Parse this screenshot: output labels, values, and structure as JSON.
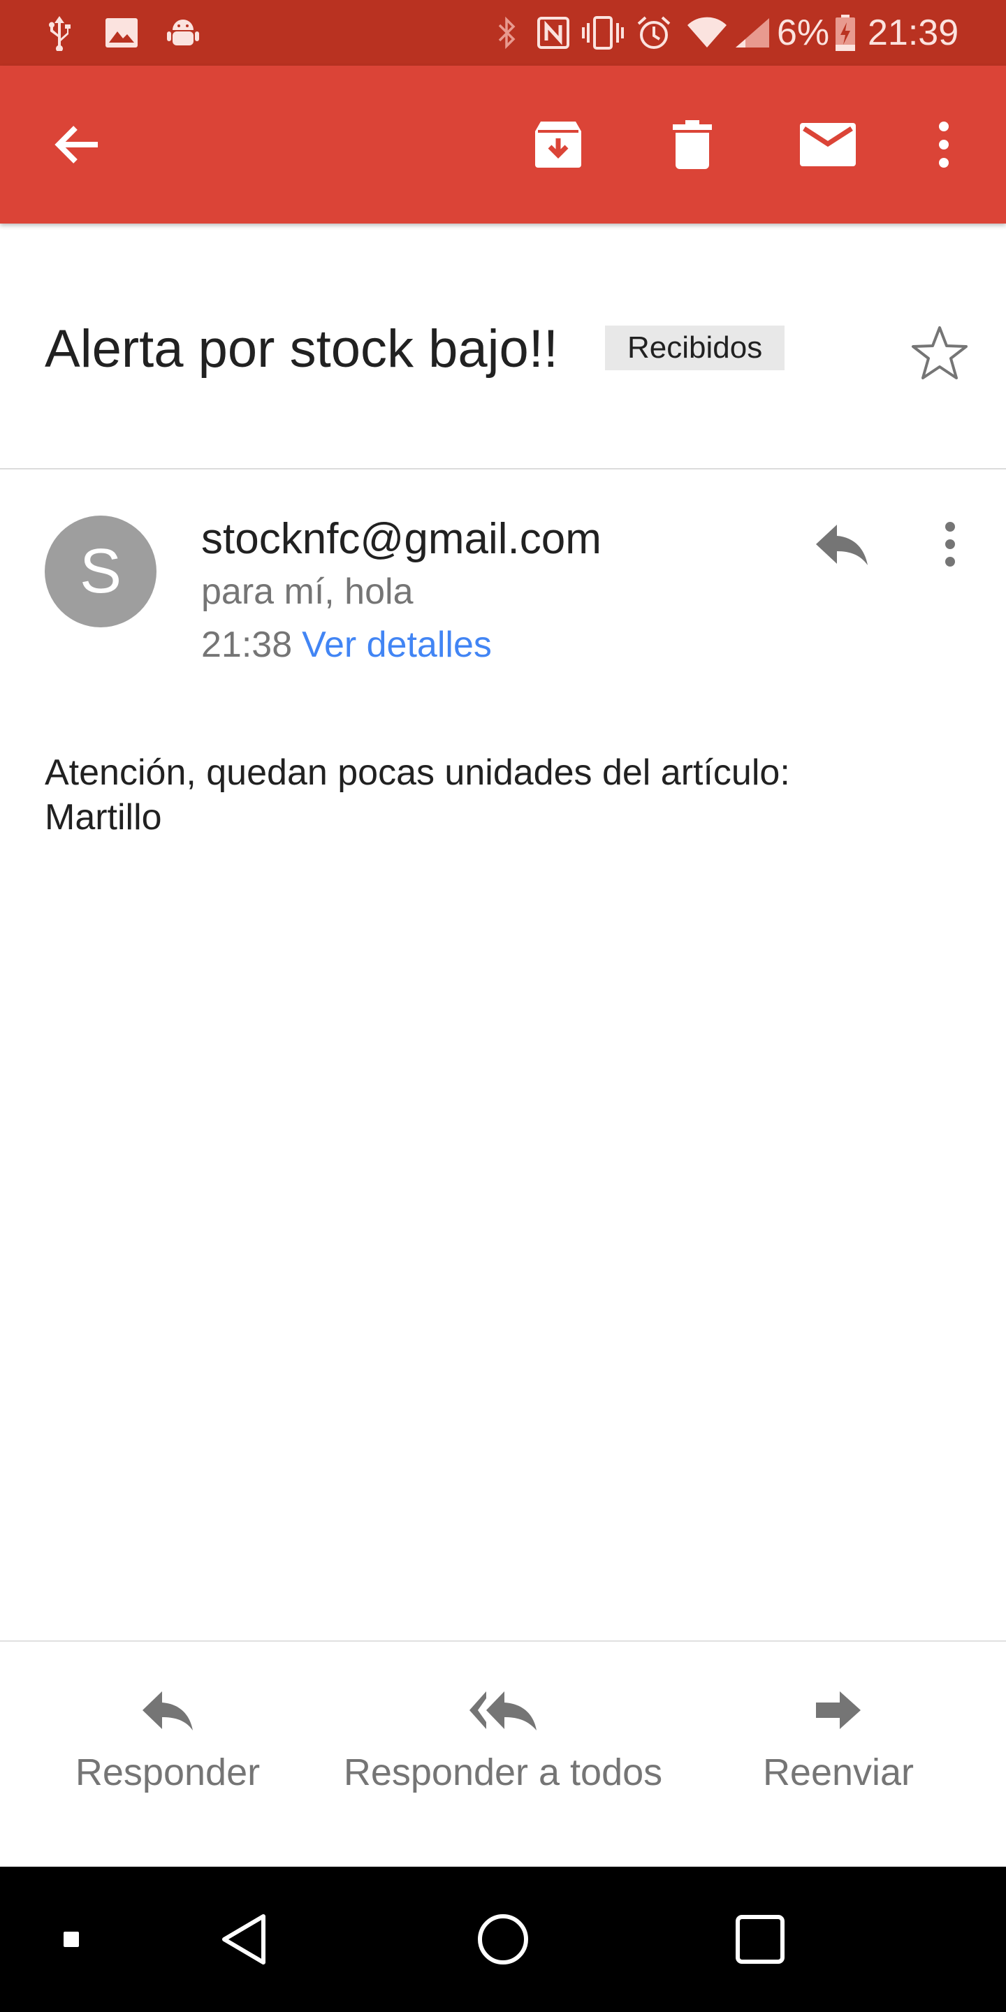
{
  "status_bar": {
    "battery_percent": "6%",
    "time": "21:39",
    "icons": [
      "usb-icon",
      "image-icon",
      "android-debug-icon",
      "bluetooth-icon",
      "nfc-icon",
      "vibrate-icon",
      "alarm-icon",
      "wifi-icon",
      "signal-icon",
      "battery-charging-icon"
    ]
  },
  "app_bar": {
    "icons": [
      "back-arrow-icon",
      "archive-icon",
      "delete-icon",
      "mark-unread-icon",
      "more-vert-icon"
    ]
  },
  "email": {
    "subject": "Alerta por stock bajo!!",
    "label": "Recibidos",
    "avatar_letter": "S",
    "sender": "stocknfc@gmail.com",
    "recipients": "para mí, hola",
    "time": "21:38",
    "details_link": "Ver detalles",
    "body_line1": "Atención, quedan pocas unidades del artículo:",
    "body_line2": "Martillo"
  },
  "actions": {
    "reply": "Responder",
    "reply_all": "Responder a todos",
    "forward": "Reenviar"
  },
  "colors": {
    "status_bar": "#b93221",
    "app_bar": "#db4437",
    "link": "#4285f4",
    "avatar": "#9e9e9e",
    "secondary_text": "#757575"
  }
}
